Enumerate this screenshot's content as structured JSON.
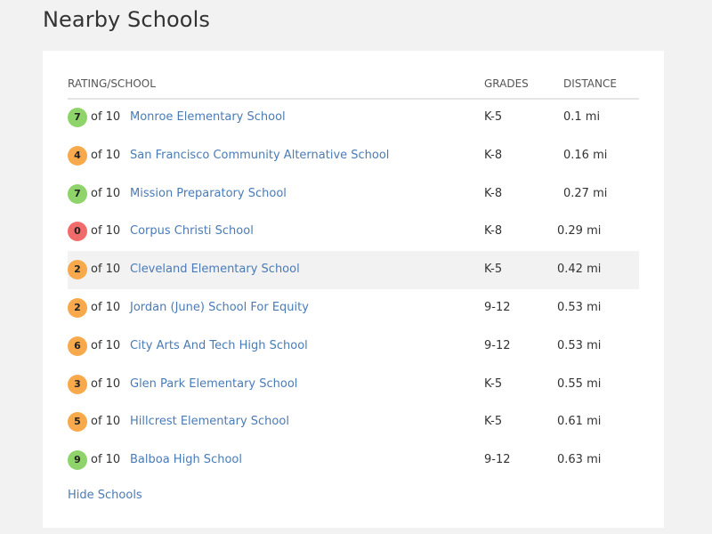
{
  "page": {
    "title": "Nearby Schools"
  },
  "table": {
    "headers": {
      "school": "RATING/SCHOOL",
      "grades": "GRADES",
      "distance": "DISTANCE"
    },
    "rows": [
      {
        "rating": "7",
        "of": "of 10",
        "school": "Monroe Elementary School",
        "grades": "K-5",
        "distance": "0.1 mi",
        "color": "#8fd46a"
      },
      {
        "rating": "4",
        "of": "of 10",
        "school": "San Francisco Community Alternative School",
        "grades": "K-8",
        "distance": "0.16 mi",
        "color": "#f7a94b"
      },
      {
        "rating": "7",
        "of": "of 10",
        "school": "Mission Preparatory School",
        "grades": "K-8",
        "distance": "0.27 mi",
        "color": "#8fd46a"
      },
      {
        "rating": "0",
        "of": "of 10",
        "school": "Corpus Christi School",
        "grades": "K-8",
        "distance": "0.29 mi",
        "color": "#f26b6b"
      },
      {
        "rating": "2",
        "of": "of 10",
        "school": "Cleveland Elementary School",
        "grades": "K-5",
        "distance": "0.42 mi",
        "color": "#f7a94b"
      },
      {
        "rating": "2",
        "of": "of 10",
        "school": "Jordan (June) School For Equity",
        "grades": "9-12",
        "distance": "0.53 mi",
        "color": "#f7a94b"
      },
      {
        "rating": "6",
        "of": "of 10",
        "school": "City Arts And Tech High School",
        "grades": "9-12",
        "distance": "0.53 mi",
        "color": "#f7a94b"
      },
      {
        "rating": "3",
        "of": "of 10",
        "school": "Glen Park Elementary School",
        "grades": "K-5",
        "distance": "0.55 mi",
        "color": "#f7a94b"
      },
      {
        "rating": "5",
        "of": "of 10",
        "school": "Hillcrest Elementary School",
        "grades": "K-5",
        "distance": "0.61 mi",
        "color": "#f7a94b"
      },
      {
        "rating": "9",
        "of": "of 10",
        "school": "Balboa High School",
        "grades": "9-12",
        "distance": "0.63 mi",
        "color": "#8fd46a"
      }
    ]
  },
  "footer": {
    "hide_label": "Hide Schools"
  }
}
